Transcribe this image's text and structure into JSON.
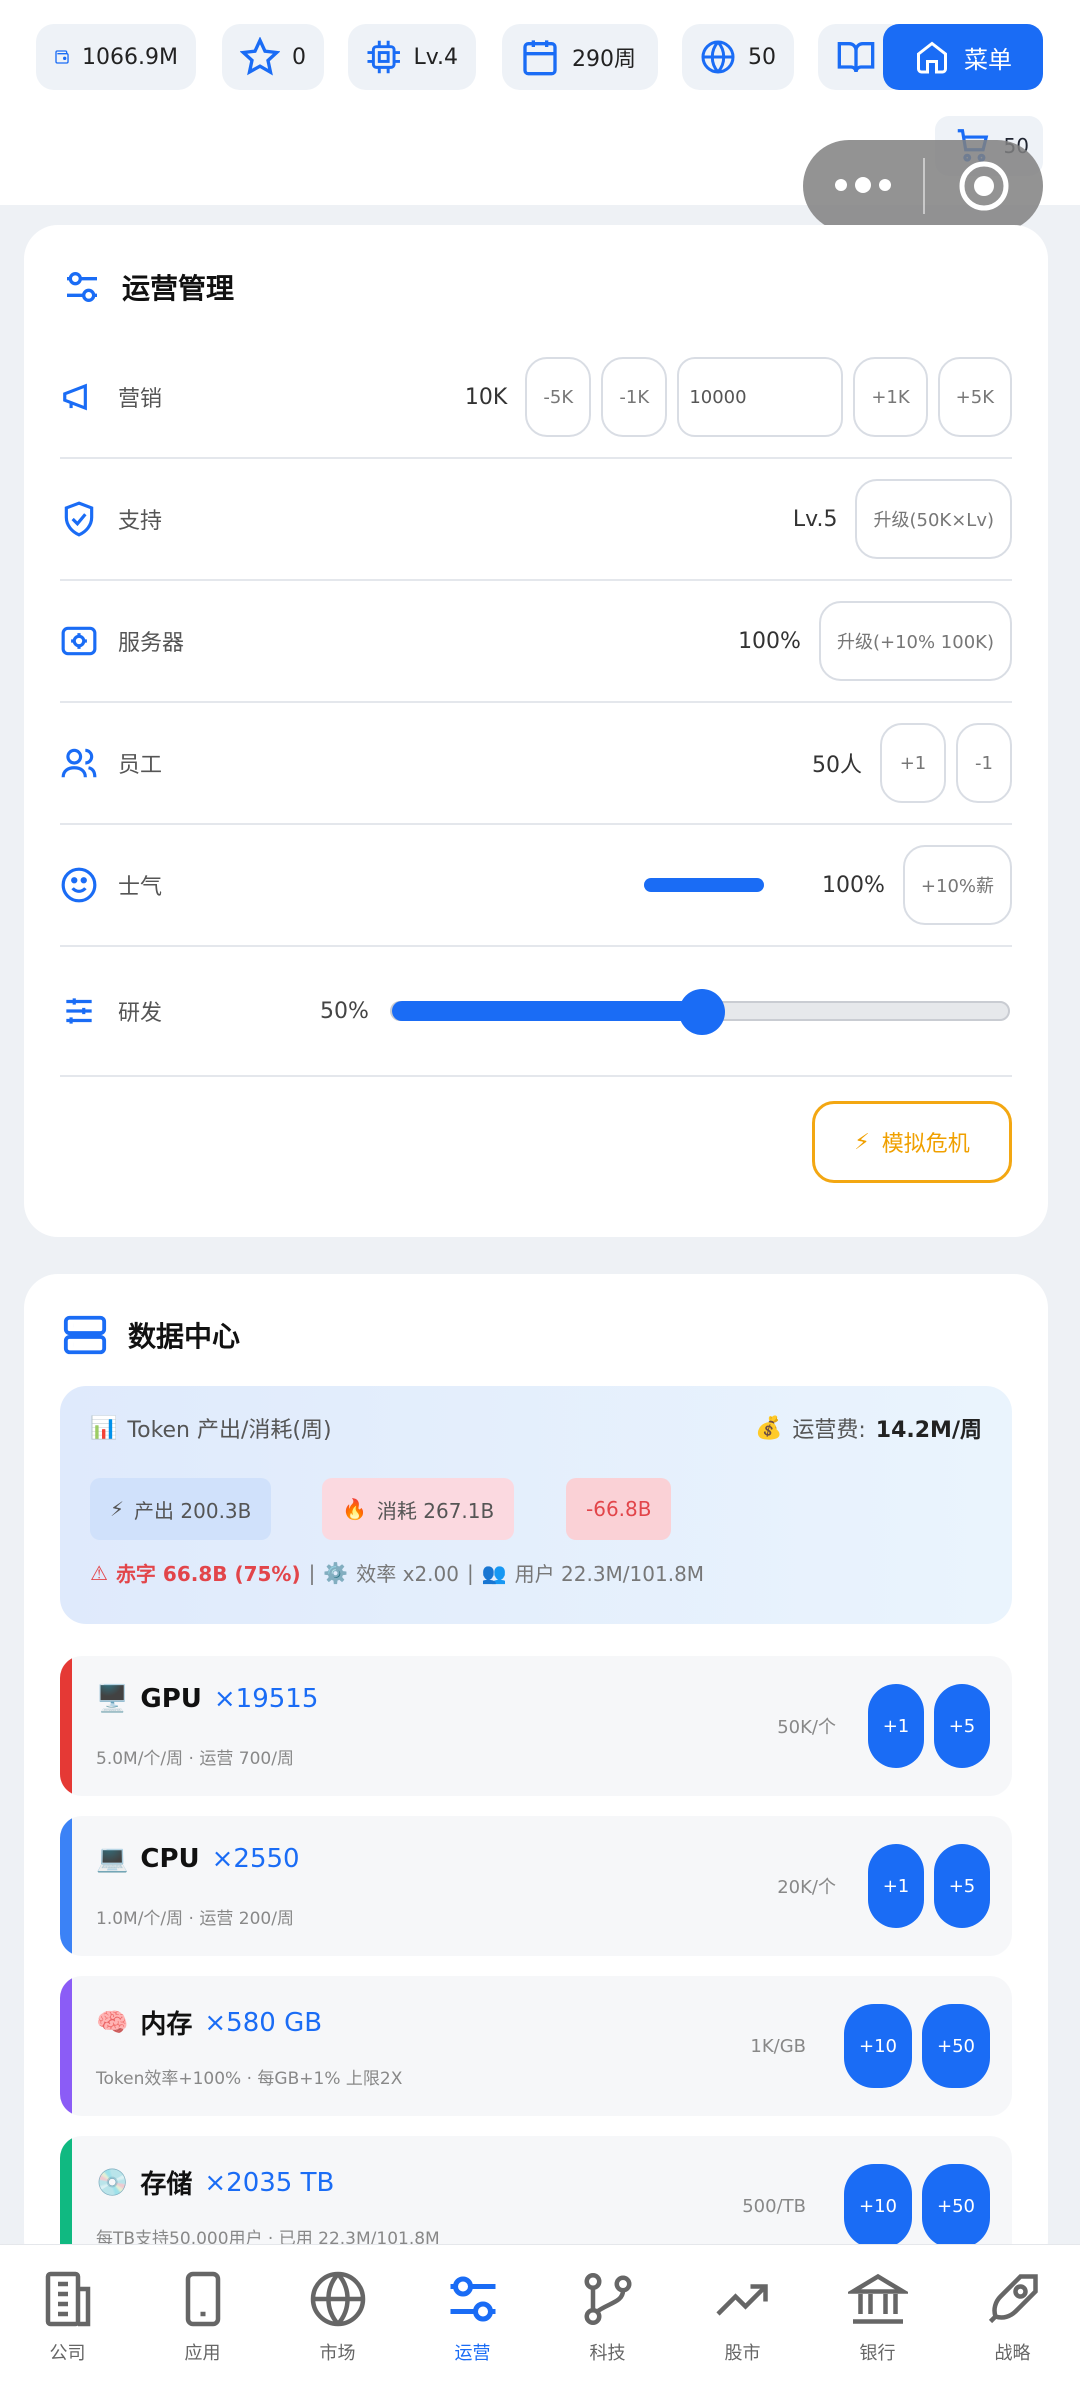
{
  "top_bar": {
    "money": "1066.9M",
    "stars": "0",
    "level": "Lv.4",
    "week": "290周",
    "regions": "50",
    "home_label": "菜单",
    "cart_count": "50"
  },
  "operations": {
    "title": "运营管理",
    "marketing": {
      "label": "营销",
      "value": "10K",
      "minus5": "-5K",
      "minus1": "-1K",
      "input_value": "10000",
      "plus1": "+1K",
      "plus5": "+5K"
    },
    "support": {
      "label": "支持",
      "value": "Lv.5",
      "button": "升级(50K×Lv)"
    },
    "server": {
      "label": "服务器",
      "value": "100%",
      "button": "升级(+10% 100K)"
    },
    "staff": {
      "label": "员工",
      "value": "50人",
      "plus": "+1",
      "minus": "-1"
    },
    "morale": {
      "label": "士气",
      "level": 1.0,
      "value": "100%",
      "button": "+10%薪"
    },
    "research": {
      "label": "研发",
      "value": "50%",
      "level": 0.5
    },
    "crisis_button": "模拟危机"
  },
  "data_center": {
    "title": "数据中心",
    "token_title": "Token 产出/消耗(周)",
    "cost_label": "运营费:",
    "cost_value": "14.2M/周",
    "production": "产出 200.3B",
    "consumption": "消耗 267.1B",
    "net": "-66.8B",
    "deficit": "赤字 66.8B (75%)",
    "efficiency": "效率 x2.00",
    "users": "用户 22.3M/101.8M",
    "hardware": [
      {
        "icon": "🖥️",
        "name": "GPU",
        "qty": "×19515",
        "desc": "5.0M/个/周 · 运营 700/周",
        "price": "50K/个",
        "btn1": "+1",
        "btn2": "+5",
        "color": "#e53935"
      },
      {
        "icon": "💻",
        "name": "CPU",
        "qty": "×2550",
        "desc": "1.0M/个/周 · 运营 200/周",
        "price": "20K/个",
        "btn1": "+1",
        "btn2": "+5",
        "color": "#3b82f6"
      },
      {
        "icon": "🧠",
        "name": "内存",
        "qty": "×580 GB",
        "desc": "Token效率+100% · 每GB+1% 上限2X",
        "price": "1K/GB",
        "btn1": "+10",
        "btn2": "+50",
        "color": "#8b5cf6"
      },
      {
        "icon": "💿",
        "name": "存储",
        "qty": "×2035 TB",
        "desc": "每TB支持50,000用户 · 已用 22.3M/101.8M",
        "price": "500/TB",
        "btn1": "+10",
        "btn2": "+50",
        "color": "#10b981"
      }
    ]
  },
  "nav": [
    {
      "label": "公司",
      "icon": "building-icon"
    },
    {
      "label": "应用",
      "icon": "phone-icon"
    },
    {
      "label": "市场",
      "icon": "globe-icon"
    },
    {
      "label": "运营",
      "icon": "operations-icon",
      "active": true
    },
    {
      "label": "科技",
      "icon": "git-branch-icon"
    },
    {
      "label": "股市",
      "icon": "trend-icon"
    },
    {
      "label": "银行",
      "icon": "bank-icon"
    },
    {
      "label": "战略",
      "icon": "rocket-icon"
    }
  ],
  "colors": {
    "accent": "#1a6cf5",
    "warning": "#f3a712",
    "danger": "#e2454a"
  }
}
